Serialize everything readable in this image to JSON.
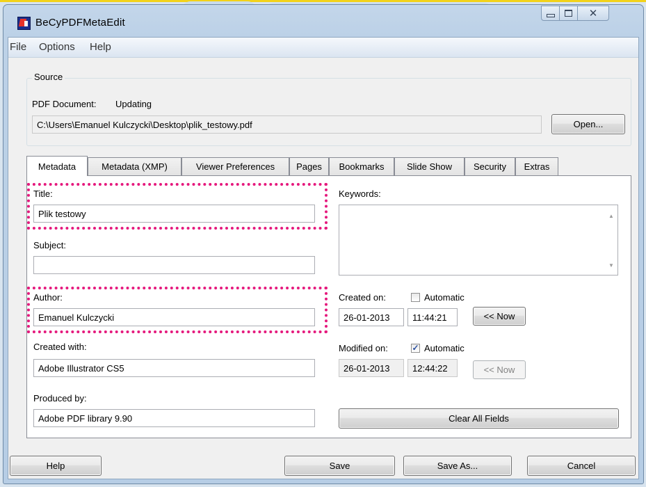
{
  "window": {
    "title": "BeCyPDFMetaEdit"
  },
  "caption_buttons": {
    "close_glyph": "✕"
  },
  "menu": [
    "File",
    "Options",
    "Help"
  ],
  "source": {
    "group_label": "Source",
    "doc_label": "PDF Document:",
    "doc_status": "Updating",
    "path": "C:\\Users\\Emanuel Kulczycki\\Desktop\\plik_testowy.pdf",
    "open_button": "Open..."
  },
  "tabs": [
    "Metadata",
    "Metadata (XMP)",
    "Viewer Preferences",
    "Pages",
    "Bookmarks",
    "Slide Show",
    "Security",
    "Extras"
  ],
  "active_tab": "Metadata",
  "metadata": {
    "title_label": "Title:",
    "title_value": "Plik testowy",
    "subject_label": "Subject:",
    "subject_value": "",
    "author_label": "Author:",
    "author_value": "Emanuel Kulczycki",
    "created_with_label": "Created with:",
    "created_with_value": "Adobe Illustrator CS5",
    "produced_by_label": "Produced by:",
    "produced_by_value": "Adobe PDF library 9.90",
    "keywords_label": "Keywords:",
    "keywords_value": "",
    "created_on_label": "Created on:",
    "created_auto_label": "Automatic",
    "created_auto_checked": false,
    "created_date": "26-01-2013",
    "created_time": "11:44:21",
    "now_button": "<< Now",
    "modified_on_label": "Modified on:",
    "modified_auto_label": "Automatic",
    "modified_auto_checked": true,
    "modified_date": "26-01-2013",
    "modified_time": "12:44:22",
    "modified_now_button": "<< Now",
    "clear_button": "Clear All Fields"
  },
  "footer": {
    "help": "Help",
    "save": "Save",
    "save_as": "Save As...",
    "cancel": "Cancel"
  },
  "colors": {
    "highlight": "#e5197d",
    "titlebar": "#bcd1e7",
    "dialog": "#f0f0f0"
  }
}
